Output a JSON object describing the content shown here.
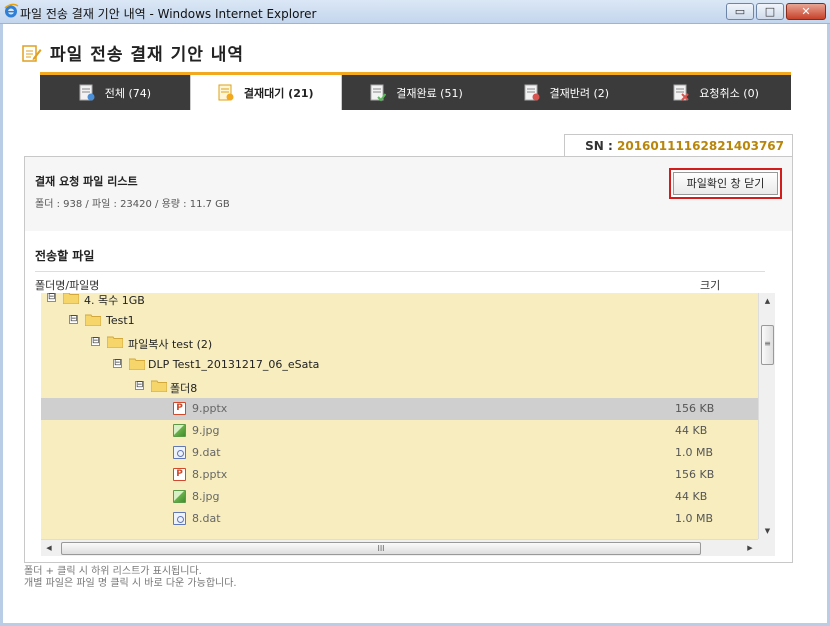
{
  "window": {
    "title": "파일 전송 결재 기안 내역 - Windows Internet Explorer",
    "minimize_glyph": "▭",
    "maximize_glyph": "□",
    "close_glyph": "✕"
  },
  "page": {
    "title": "파일 전송 결재 기안 내역"
  },
  "tabs": [
    {
      "label": "전체 (74)",
      "icon": "document-icon",
      "active": false
    },
    {
      "label": "결재대기 (21)",
      "icon": "pending-doc-icon",
      "active": true
    },
    {
      "label": "결재완료 (51)",
      "icon": "approved-doc-icon",
      "active": false
    },
    {
      "label": "결재반려 (2)",
      "icon": "rejected-doc-icon",
      "active": false
    },
    {
      "label": "요청취소 (0)",
      "icon": "cancel-doc-icon",
      "active": false
    }
  ],
  "sn": {
    "label": "SN :",
    "value": "20160111162821403767"
  },
  "request": {
    "title": "결재 요청 파일 리스트",
    "meta": "폴더 : 938 / 파일 : 23420 / 용량 : 11.7 GB",
    "close_button": "파일확인 창 닫기"
  },
  "file_list": {
    "title": "전송할 파일",
    "col_name": "폴더명/파일명",
    "col_size": "크기",
    "rows": [
      {
        "type": "folder",
        "expander": "⊟",
        "name": "4. 목수 1GB",
        "size": ""
      },
      {
        "type": "folder",
        "expander": "⊟",
        "name": "Test1",
        "size": ""
      },
      {
        "type": "folder",
        "expander": "⊟",
        "name": "파일복사 test (2)",
        "size": ""
      },
      {
        "type": "folder",
        "expander": "⊟",
        "name": "DLP Test1_20131217_06_eSata",
        "size": ""
      },
      {
        "type": "folder",
        "expander": "⊟",
        "name": "폴더8",
        "size": ""
      },
      {
        "type": "pptx",
        "name": "9.pptx",
        "size": "156 KB",
        "selected": true
      },
      {
        "type": "jpg",
        "name": "9.jpg",
        "size": "44 KB"
      },
      {
        "type": "dat",
        "name": "9.dat",
        "size": "1.0 MB"
      },
      {
        "type": "pptx",
        "name": "8.pptx",
        "size": "156 KB"
      },
      {
        "type": "jpg",
        "name": "8.jpg",
        "size": "44 KB"
      },
      {
        "type": "dat",
        "name": "8.dat",
        "size": "1.0 MB"
      }
    ]
  },
  "scrollbar": {
    "up": "▲",
    "down": "▼",
    "left": "◀",
    "right": "▶",
    "v_grip": "≡",
    "h_grip": "III"
  },
  "hints": [
    "폴더 + 클릭 시 하위 리스트가 표시됩니다.",
    "개별 파일은 파일 명 클릭 시 바로 다운 가능합니다."
  ],
  "colors": {
    "tab_bar": "#3b3b3b",
    "accent": "#f2a91f",
    "tree_bg": "#f7edbf",
    "selected_row": "#cfcfcf",
    "sn_value": "#b8860b",
    "close_button_border": "#d31c1c"
  }
}
